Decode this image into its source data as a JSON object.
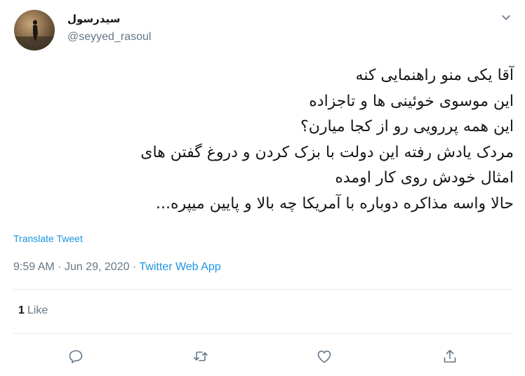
{
  "user": {
    "display_name": "سیدرسول",
    "handle": "@seyyed_rasoul"
  },
  "tweet": {
    "lines": [
      "آقا یکی منو راهنمایی کنه",
      "این موسوی خوئینی ها و تاجزاده",
      "این همه پررویی رو از کجا میارن؟",
      "مردک یادش رفته این دولت با بزک کردن و دروغ گفتن های",
      "امثال خودش روی کار اومده",
      "حالا واسه مذاکره دوباره با آمریکا چه بالا و پایین میپره..."
    ],
    "translate_label": "Translate Tweet",
    "time": "9:59 AM",
    "separator": "·",
    "date": "Jun 29, 2020",
    "source_app": "Twitter Web App"
  },
  "stats": {
    "likes_count": "1",
    "likes_label": "Like"
  },
  "actions": [
    "reply-icon",
    "retweet-icon",
    "like-icon",
    "share-icon"
  ],
  "colors": {
    "link": "#1b95e0",
    "muted": "#657786",
    "text": "#14171a",
    "divider": "#e6ecf0"
  }
}
